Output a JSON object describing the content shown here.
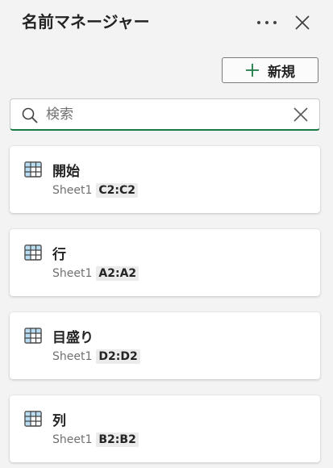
{
  "header": {
    "title": "名前マネージャー",
    "more_icon": "more-horizontal-icon",
    "close_icon": "close-icon"
  },
  "toolbar": {
    "new_label": "新規",
    "new_icon": "plus-icon",
    "accent_color": "#1b7a43"
  },
  "search": {
    "placeholder": "検索",
    "value": ""
  },
  "names": [
    {
      "name": "開始",
      "sheet": "Sheet1",
      "range": "C2:C2"
    },
    {
      "name": "行",
      "sheet": "Sheet1",
      "range": "A2:A2"
    },
    {
      "name": "目盛り",
      "sheet": "Sheet1",
      "range": "D2:D2"
    },
    {
      "name": "列",
      "sheet": "Sheet1",
      "range": "B2:B2"
    }
  ]
}
